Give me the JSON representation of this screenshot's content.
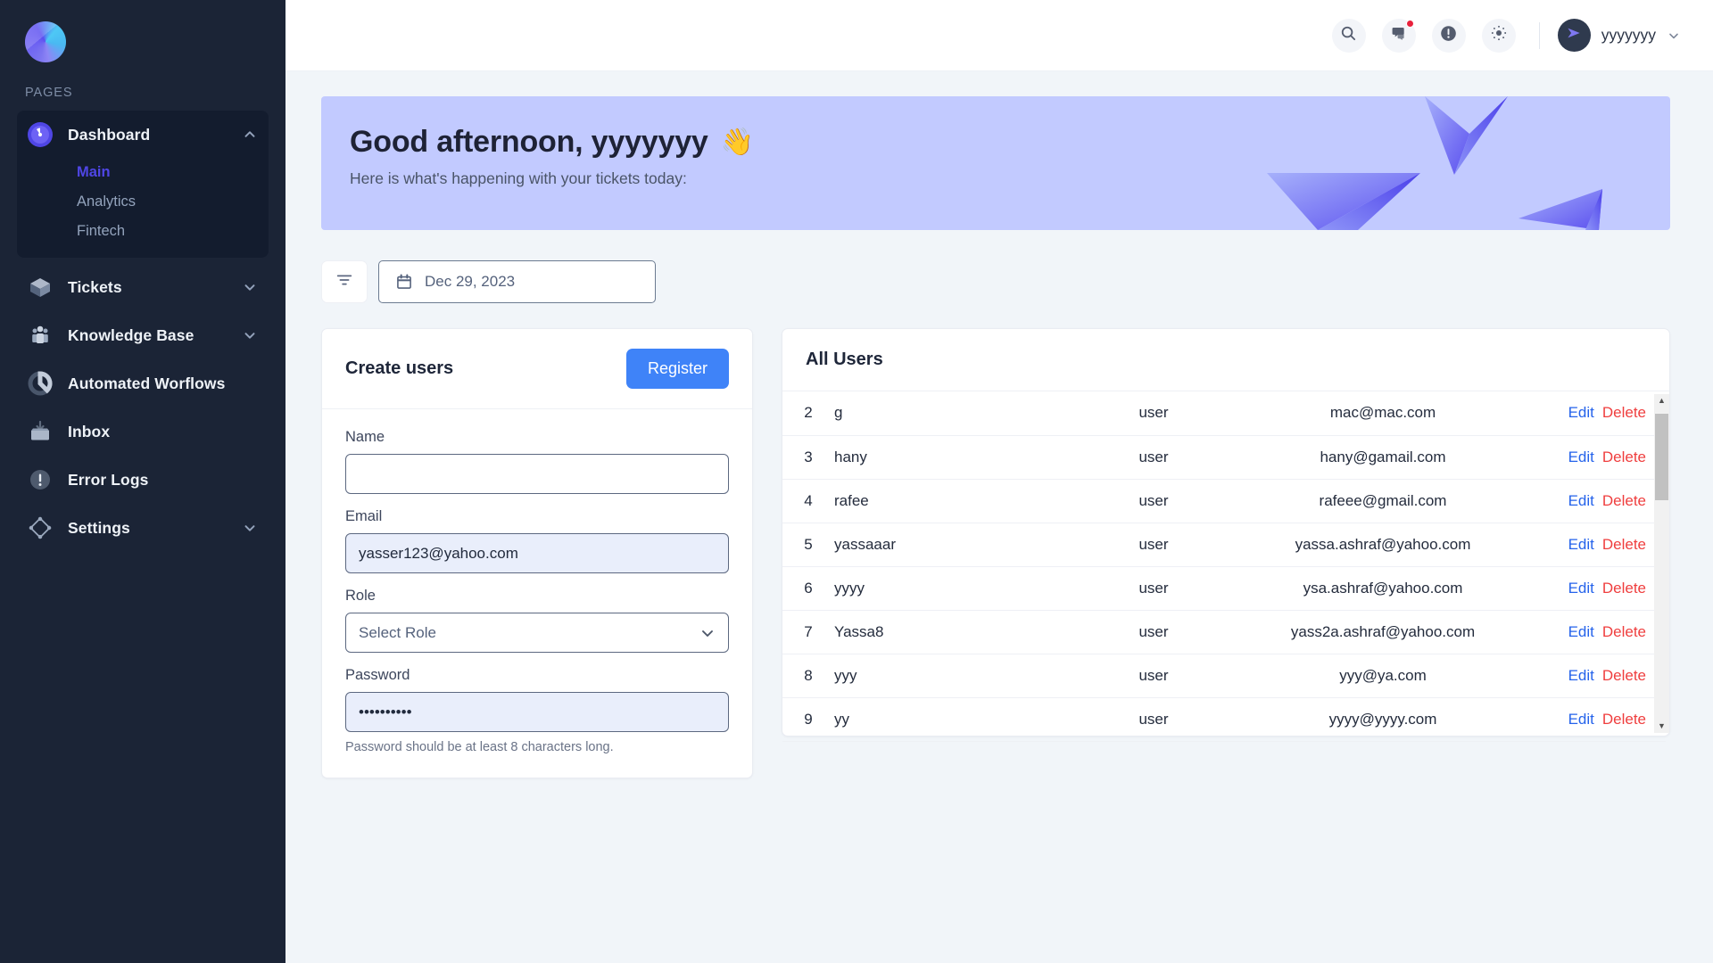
{
  "sidebar": {
    "section_label": "PAGES",
    "logo_name": "app-logo",
    "items": [
      {
        "label": "Dashboard",
        "icon": "gauge-icon",
        "expanded": true,
        "children": [
          {
            "label": "Main",
            "selected": true
          },
          {
            "label": "Analytics",
            "selected": false
          },
          {
            "label": "Fintech",
            "selected": false
          }
        ]
      },
      {
        "label": "Tickets",
        "icon": "box-icon",
        "expanded": false
      },
      {
        "label": "Knowledge Base",
        "icon": "people-icon",
        "expanded": false
      },
      {
        "label": "Automated Worflows",
        "icon": "donut-chart-icon"
      },
      {
        "label": "Inbox",
        "icon": "inbox-icon"
      },
      {
        "label": "Error Logs",
        "icon": "alert-circle-icon"
      },
      {
        "label": "Settings",
        "icon": "settings-node-icon",
        "expanded": false
      }
    ]
  },
  "topbar": {
    "search_icon": "search-icon",
    "chat_icon": "chat-icon",
    "alert_icon": "alert-circle-icon",
    "theme_icon": "brightness-icon",
    "has_notification": true,
    "avatar_icon": "paper-plane-icon",
    "username": "yyyyyyy",
    "chevron_icon": "chevron-down-icon"
  },
  "banner": {
    "greeting": "Good afternoon, yyyyyyy",
    "wave_emoji": "👋",
    "subtitle": "Here is what's happening with your tickets today:",
    "bg_color": "#c2caff"
  },
  "filters": {
    "filter_icon": "filter-icon",
    "calendar_icon": "calendar-icon",
    "date_value": "Dec 29, 2023"
  },
  "create_users": {
    "title": "Create users",
    "register_label": "Register",
    "register_color": "#3f83f8",
    "fields": {
      "name_label": "Name",
      "name_value": "",
      "email_label": "Email",
      "email_value": "yasser123@yahoo.com",
      "role_label": "Role",
      "role_value": "Select Role",
      "role_chevron": "chevron-down-icon",
      "password_label": "Password",
      "password_value": "••••••••••",
      "password_hint": "Password should be at least 8 characters long."
    }
  },
  "all_users": {
    "title": "All Users",
    "edit_label": "Edit",
    "delete_label": "Delete",
    "edit_color": "#2563eb",
    "delete_color": "#ef3e3e",
    "rows": [
      {
        "id": "2",
        "name": "g",
        "role": "user",
        "email": "mac@mac.com"
      },
      {
        "id": "3",
        "name": "hany",
        "role": "user",
        "email": "hany@gamail.com"
      },
      {
        "id": "4",
        "name": "rafee",
        "role": "user",
        "email": "rafeee@gmail.com"
      },
      {
        "id": "5",
        "name": "yassaaar",
        "role": "user",
        "email": "yassa.ashraf@yahoo.com"
      },
      {
        "id": "6",
        "name": "yyyy",
        "role": "user",
        "email": "ysa.ashraf@yahoo.com"
      },
      {
        "id": "7",
        "name": "Yassa8",
        "role": "user",
        "email": "yass2a.ashraf@yahoo.com"
      },
      {
        "id": "8",
        "name": "yyy",
        "role": "user",
        "email": "yyy@ya.com"
      },
      {
        "id": "9",
        "name": "yy",
        "role": "user",
        "email": "yyyy@yyyy.com"
      }
    ],
    "scroll_up_icon": "▲",
    "scroll_down_icon": "▼"
  }
}
